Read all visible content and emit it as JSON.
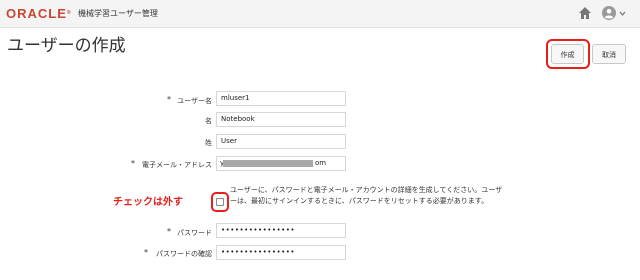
{
  "header": {
    "logo_text": "ORACLE",
    "logo_mark": "®",
    "app_name": "機械学習ユーザー管理",
    "home_icon": "home-icon",
    "user_icon": "user-icon"
  },
  "page": {
    "title": "ユーザーの作成"
  },
  "actions": {
    "create_label": "作成",
    "cancel_label": "取消"
  },
  "form": {
    "required_mark": "*",
    "username": {
      "label": "ユーザー名",
      "value": "mluser1",
      "required": true
    },
    "first_name": {
      "label": "名",
      "value": "Notebook",
      "required": false
    },
    "last_name": {
      "label": "姓",
      "value": "User",
      "required": false
    },
    "email": {
      "label": "電子メール・アドレス",
      "value_prefix": "y",
      "value_suffix": "om",
      "required": true
    },
    "generate_password": {
      "checked": false,
      "description": "ユーザーに、パスワードと電子メール・アカウントの詳細を生成してください。ユーザーは、最初にサインインするときに、パスワードをリセットする必要があります。"
    },
    "password": {
      "label": "パスワード",
      "value": "••••••••••••••••",
      "required": true
    },
    "confirm_password": {
      "label": "パスワードの確認",
      "value": "••••••••••••••••",
      "required": true
    }
  },
  "annotation": {
    "text": "チェックは外す",
    "color": "#e8201b"
  },
  "colors": {
    "oracle_red": "#c74634",
    "highlight_red": "#e8201b"
  }
}
